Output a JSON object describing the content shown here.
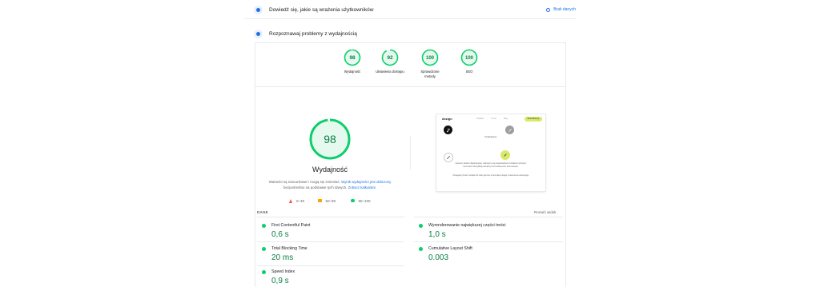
{
  "sections": {
    "experience_title": "Dowiedź się, jakie są wrażenia użytkowników",
    "no_data_label": "Brak danych",
    "diagnose_title": "Rozpoznawaj problemy z wydajnością"
  },
  "scores": [
    {
      "value": "98",
      "label": "Wydajność",
      "score": 98
    },
    {
      "value": "92",
      "label": "Ułatwienia dostępu",
      "score": 92
    },
    {
      "value": "100",
      "label": "Sprawdzone metody",
      "score": 100
    },
    {
      "value": "100",
      "label": "SEO",
      "score": 100
    }
  ],
  "performance": {
    "score": "98",
    "title": "Wydajność",
    "desc_prefix": "Wartości są szacunkowe i mogą się zmieniać. ",
    "desc_link1": "Wynik wydajności jest obliczony",
    "desc_middle": " bezpośrednio na podstawie tych danych. ",
    "desc_link2": "Zobacz kalkulator."
  },
  "legend": {
    "fail": "0–49",
    "average": "50–89",
    "pass": "90–100"
  },
  "screenshot": {
    "logo": "dezign",
    "nav": [
      "Projekty",
      "O nas",
      "Blog"
    ],
    "cta": "Skontaktuj się",
    "caption": "Projektujemy",
    "para1": "Jesteśmy studiem digital designu. Zajmujemy się projektowaniem produktów cyfrowych, tworzeniem identyfikacji wizualnej oraz budową stron internetowych.",
    "para2": "Pomagamy firmom rozwijać ich marki poprzez przemyślany design i nowoczesne technologie."
  },
  "metrics_header": {
    "label": "DANE",
    "expand": "Rozwiń widok"
  },
  "metrics": [
    {
      "name": "First Contentful Paint",
      "value": "0,6 s"
    },
    {
      "name": "Wyrenderowanie największej części treści",
      "value": "1,0 s"
    },
    {
      "name": "Total Blocking Time",
      "value": "20 ms"
    },
    {
      "name": "Cumulative Layout Shift",
      "value": "0.003"
    },
    {
      "name": "Speed Index",
      "value": "0,9 s"
    }
  ],
  "colors": {
    "pass": "#0cce6b",
    "pass_text": "#0b8043",
    "average": "#ffa400",
    "fail": "#ff4e42",
    "link": "#1a73e8"
  }
}
